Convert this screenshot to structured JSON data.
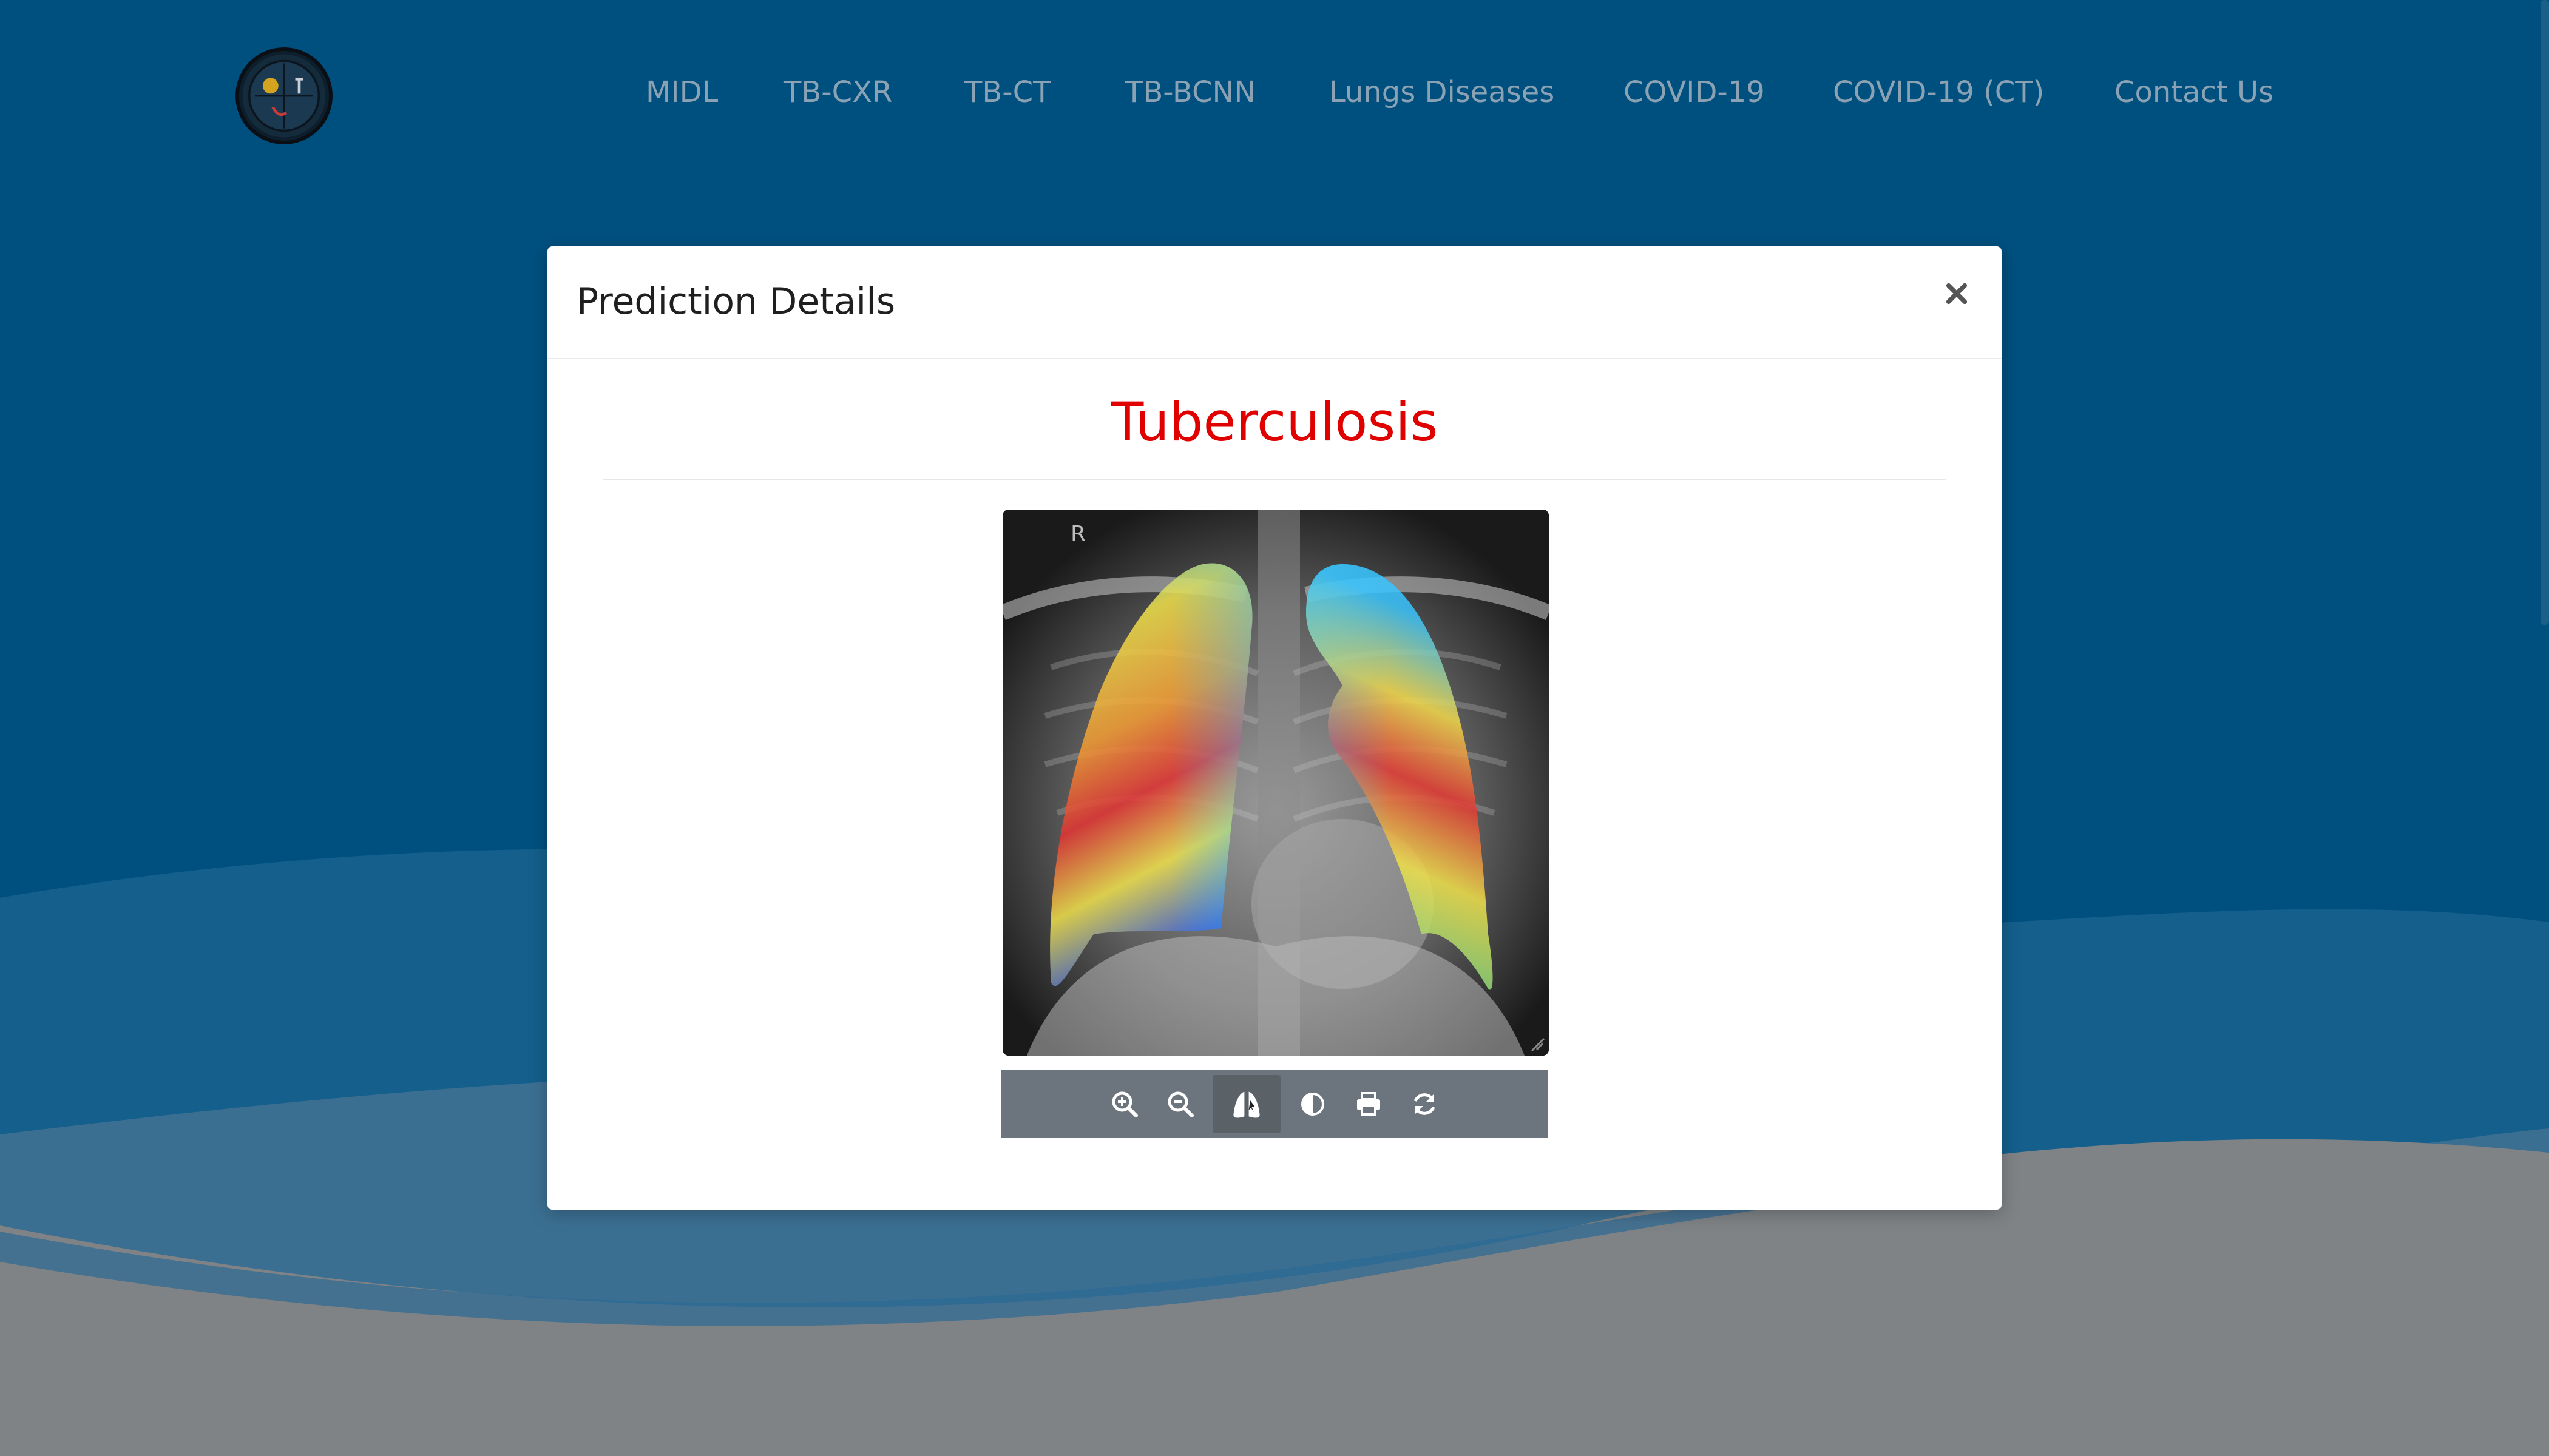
{
  "nav": {
    "items": [
      {
        "label": "MIDL"
      },
      {
        "label": "TB-CXR"
      },
      {
        "label": "TB-CT"
      },
      {
        "label": "TB-BCNN"
      },
      {
        "label": "Lungs Diseases"
      },
      {
        "label": "COVID-19"
      },
      {
        "label": "COVID-19 (CT)"
      },
      {
        "label": "Contact Us"
      }
    ]
  },
  "modal": {
    "title": "Prediction Details",
    "close_icon": "close-icon",
    "prediction": "Tuberculosis",
    "prediction_color": "#e00000",
    "xray_marker": "R"
  },
  "toolbar": {
    "tools": [
      {
        "name": "zoom-in-icon"
      },
      {
        "name": "zoom-out-icon"
      },
      {
        "name": "lungs-icon"
      },
      {
        "name": "contrast-icon"
      },
      {
        "name": "print-icon"
      },
      {
        "name": "refresh-icon"
      }
    ]
  },
  "colors": {
    "background": "#00507f",
    "nav_text": "#8aa2b4",
    "toolbar": "#6c757d",
    "prediction": "#e00000"
  }
}
